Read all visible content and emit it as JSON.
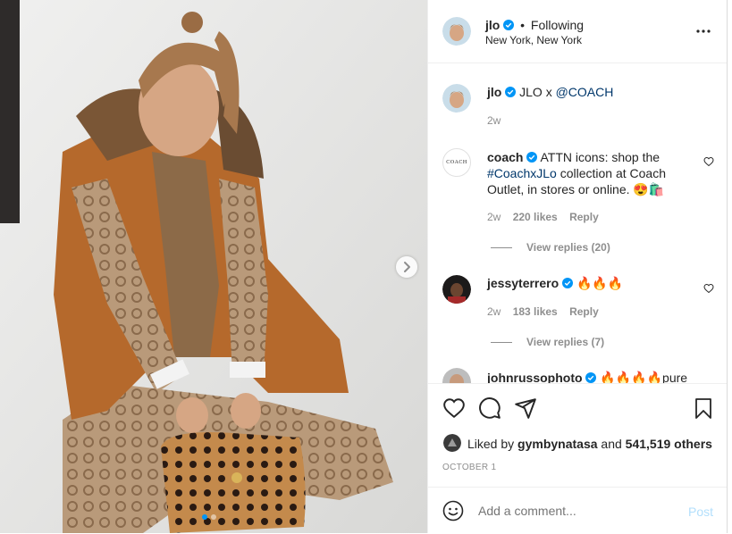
{
  "post": {
    "username": "jlo",
    "follow_status": "Following",
    "location": "New York, New York",
    "more_icon": "more-horizontal-icon"
  },
  "caption": {
    "username": "jlo",
    "text": "JLO x",
    "mention": "@COACH",
    "age": "2w"
  },
  "comments": [
    {
      "username": "coach",
      "avatar_text": "COACH",
      "text_before": "ATTN icons: shop the",
      "hashtag": "#CoachxJLo",
      "text_after": "collection at Coach",
      "text_line3": "Outlet, in stores or online.",
      "emoji": "😍🛍️",
      "age": "2w",
      "likes": "220 likes",
      "reply": "Reply",
      "view_replies": "View replies (20)"
    },
    {
      "username": "jessyterrero",
      "text": "🔥🔥🔥",
      "age": "2w",
      "likes": "183 likes",
      "reply": "Reply",
      "view_replies": "View replies (7)"
    },
    {
      "username": "johnrussophoto",
      "text": "🔥🔥🔥🔥pure"
    }
  ],
  "actions": {
    "icons": [
      "heart-icon",
      "comment-icon",
      "share-icon",
      "bookmark-icon"
    ]
  },
  "likes": {
    "prefix": "Liked by",
    "user": "gymbynatasa",
    "middle": "and",
    "count": "541,519 others"
  },
  "date": "OCTOBER 1",
  "add_comment": {
    "placeholder": "Add a comment...",
    "post_label": "Post"
  },
  "carousel": {
    "slide_count": 2,
    "active_slide": 1
  },
  "colors": {
    "link": "#00376b",
    "verified": "#0095f6",
    "post_button": "#b2dffc",
    "muted": "#8e8e8e"
  }
}
